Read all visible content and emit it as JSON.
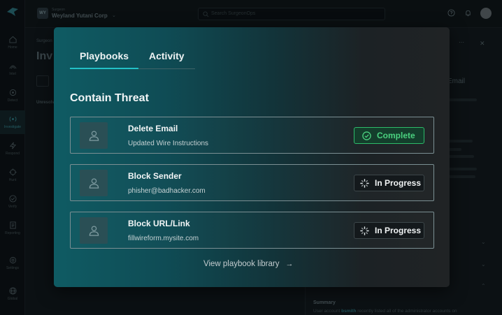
{
  "app": {
    "org_label": "Surgeon",
    "org_name": "Weyland Yutani Corp",
    "org_badge": "WY",
    "search_placeholder": "Search SurgeonOps",
    "page_crumb": "Surgeon",
    "page_title": "Inv",
    "page_sub": "Unresolved"
  },
  "rail": {
    "items": [
      {
        "label": "Home",
        "icon": "home-icon"
      },
      {
        "label": "Intel",
        "icon": "intel-icon"
      },
      {
        "label": "Detect",
        "icon": "detect-icon"
      },
      {
        "label": "Investigate",
        "icon": "investigate-icon"
      },
      {
        "label": "Respond",
        "icon": "respond-icon"
      },
      {
        "label": "Hunt",
        "icon": "hunt-icon"
      },
      {
        "label": "Verify",
        "icon": "verify-icon"
      },
      {
        "label": "Reporting",
        "icon": "reporting-icon"
      },
      {
        "label": "Settings",
        "icon": "settings-icon"
      },
      {
        "label": "Global",
        "icon": "globe-icon"
      }
    ],
    "active_index": 3
  },
  "right_panel": {
    "heading": "Email",
    "summary_label": "Summary",
    "summary_prefix": "User account",
    "summary_highlight": "bsmith",
    "summary_suffix": "recently listed all of the administrator accounts on"
  },
  "modal": {
    "tabs": [
      {
        "label": "Playbooks",
        "active": true
      },
      {
        "label": "Activity",
        "active": false
      }
    ],
    "section_title": "Contain Threat",
    "cards": [
      {
        "title": "Delete Email",
        "subtitle": "Updated Wire Instructions",
        "status": "Complete",
        "status_type": "complete"
      },
      {
        "title": "Block Sender",
        "subtitle": "phisher@badhacker.com",
        "status": "In Progress",
        "status_type": "progress"
      },
      {
        "title": "Block URL/Link",
        "subtitle": "fillwireform.mysite.com",
        "status": "In Progress",
        "status_type": "progress"
      }
    ],
    "library_link": "View playbook library",
    "colors": {
      "accent": "#23c0c6",
      "complete": "#4ad17f",
      "modal_teal": "#0f5b63"
    }
  }
}
